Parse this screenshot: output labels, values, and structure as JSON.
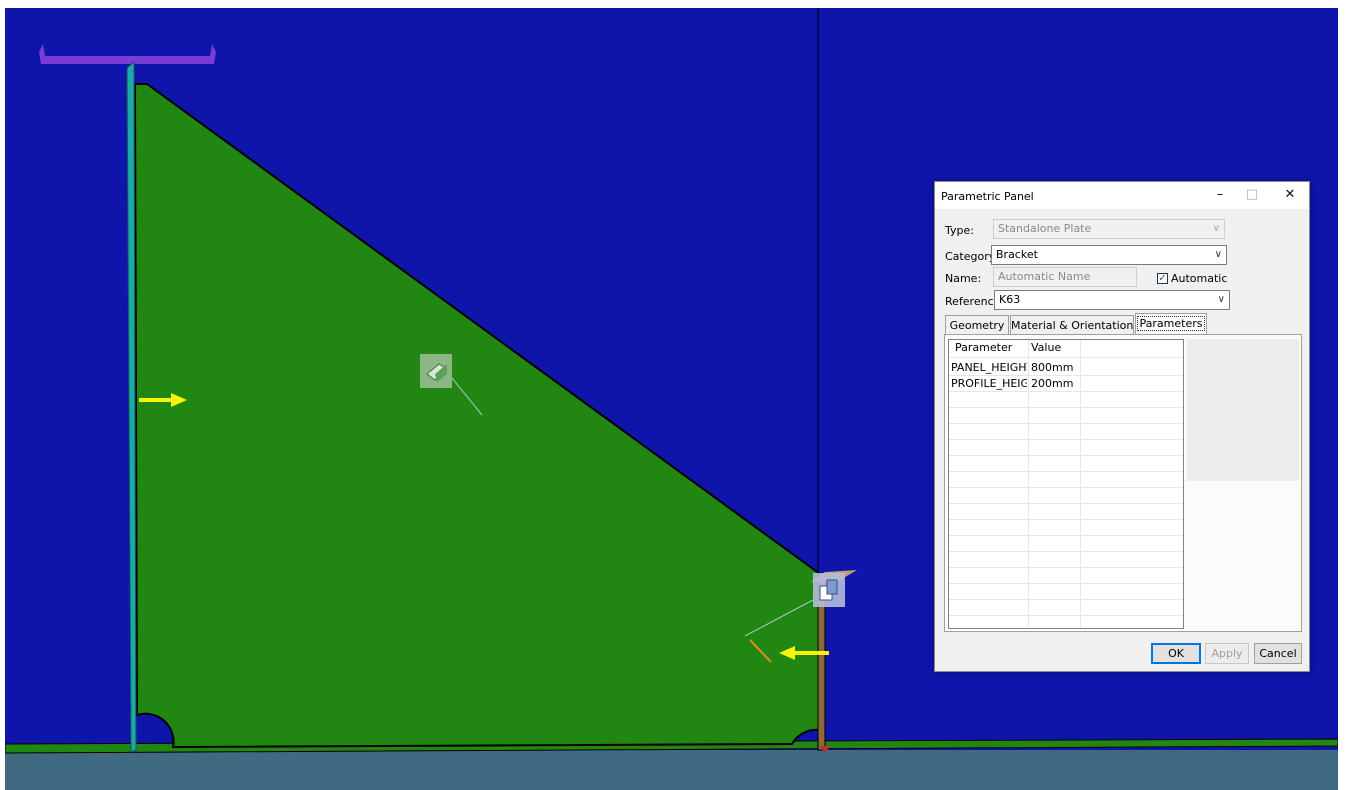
{
  "dialog": {
    "title": "Parametric Panel",
    "controls": {
      "minimize": "–",
      "maximize": "□",
      "close": "✕"
    },
    "type_label": "Type:",
    "type_value": "Standalone Plate",
    "category_label": "Category:",
    "category_value": "Bracket",
    "name_label": "Name:",
    "name_value": "Automatic Name",
    "automatic_label": "Automatic",
    "automatic_checked": true,
    "reference_label": "Reference:",
    "reference_value": "K63",
    "tabs": [
      "Geometry",
      "Material & Orientation",
      "Parameters"
    ],
    "active_tab": "Parameters",
    "grid": {
      "headers": [
        "Parameter",
        "Value"
      ],
      "rows": [
        {
          "parameter": "PANEL_HEIGHT",
          "value": "800mm"
        },
        {
          "parameter": "PROFILE_HEIG...",
          "value": "200mm"
        }
      ]
    },
    "buttons": {
      "ok": "OK",
      "apply": "Apply",
      "cancel": "Cancel"
    }
  },
  "icons": [
    "checkbox-check-icon",
    "chevron-down-icon",
    "plate-handle-icon",
    "bracket-handle-icon",
    "direction-arrow-icon"
  ],
  "colors": {
    "background": "#0f14ab",
    "plate": "#228712",
    "floor": "#3f6a82",
    "arrow": "#f5f50a",
    "dialog": "#f0f0f0",
    "ok_border": "#0078d7"
  }
}
